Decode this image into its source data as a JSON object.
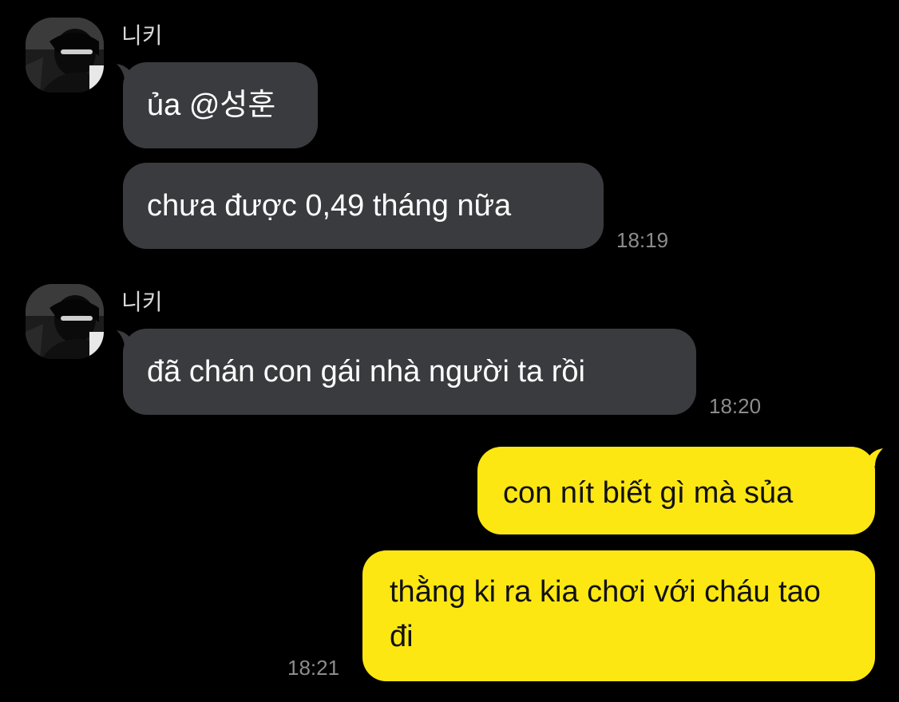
{
  "colors": {
    "background": "#000000",
    "incoming_bubble": "#3a3b3f",
    "outgoing_bubble": "#fde712",
    "timestamp": "#8c8c8c"
  },
  "messages": [
    {
      "sender": "니키",
      "avatar_icon": "profile-photo-avatar",
      "bubbles": [
        {
          "text": "ủa @성훈"
        },
        {
          "text": "chưa được 0,49 tháng nữa"
        }
      ],
      "time": "18:19"
    },
    {
      "sender": "니키",
      "avatar_icon": "profile-photo-avatar",
      "bubbles": [
        {
          "text": "đã chán con gái nhà người ta rồi"
        }
      ],
      "time": "18:20"
    },
    {
      "sender": "",
      "bubbles": [
        {
          "text": "con nít biết gì mà sủa"
        },
        {
          "text": "thằng ki ra kia chơi với cháu tao đi"
        }
      ],
      "time": "18:21"
    }
  ]
}
